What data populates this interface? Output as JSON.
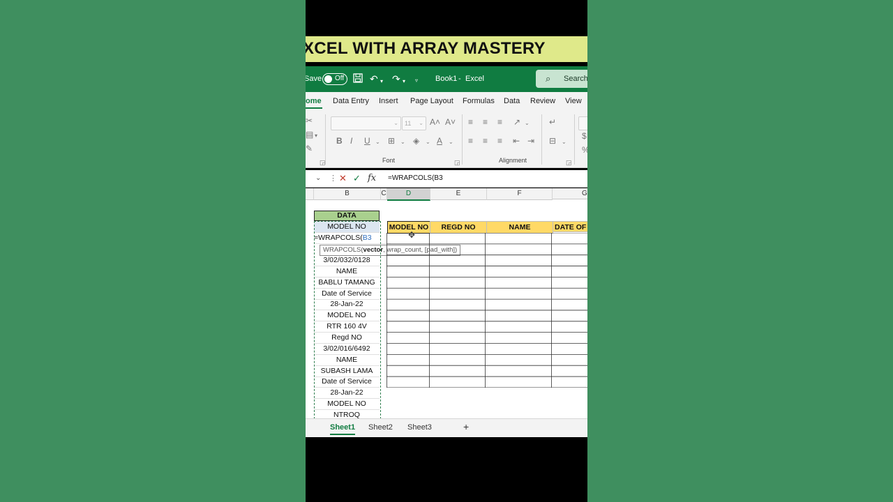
{
  "banner": {
    "text": "XCEL WITH ARRAY MASTERY"
  },
  "titlebar": {
    "autosave_label": "Save",
    "toggle_state": "Off",
    "workbook": "Book1",
    "separator": "-",
    "app": "Excel",
    "search_placeholder": "Search"
  },
  "ribbon_tabs": [
    "ome",
    "Data Entry",
    "Insert",
    "Page Layout",
    "Formulas",
    "Data",
    "Review",
    "View"
  ],
  "ribbon": {
    "font_size": "11",
    "font_group_label": "Font",
    "alignment_group_label": "Alignment",
    "bold": "B",
    "italic": "I",
    "underline": "U"
  },
  "formula_bar": {
    "formula": "=WRAPCOLS(B3",
    "fx_label": "fx"
  },
  "columns": [
    "B",
    "C",
    "D",
    "E",
    "F",
    "G"
  ],
  "column_b": {
    "header": "DATA",
    "first": "MODEL NO",
    "editing": "=WRAPCOLS(",
    "editing_ref": "B3",
    "rows": [
      "3/02/032/0128",
      "NAME",
      "BABLU TAMANG",
      "Date of Service",
      "28-Jan-22",
      "MODEL NO",
      "RTR 160 4V",
      "Regd NO",
      "3/02/016/6492",
      "NAME",
      "SUBASH LAMA",
      "Date of Service",
      "28-Jan-22",
      "MODEL NO",
      "NTROQ"
    ]
  },
  "output_headers": [
    "MODEL NO",
    "REGD NO",
    "NAME",
    "DATE OF S"
  ],
  "tooltip": {
    "fn": "WRAPCOLS(",
    "bold_arg": "vector",
    "rest": ", wrap_count, [pad_with])"
  },
  "sheets": [
    "Sheet1",
    "Sheet2",
    "Sheet3"
  ],
  "add_sheet": "+",
  "colors": {
    "excel_green": "#107c41",
    "banner_bg": "#dfe98a",
    "header_green": "#a9d08e",
    "output_header_yellow": "#ffd966"
  }
}
